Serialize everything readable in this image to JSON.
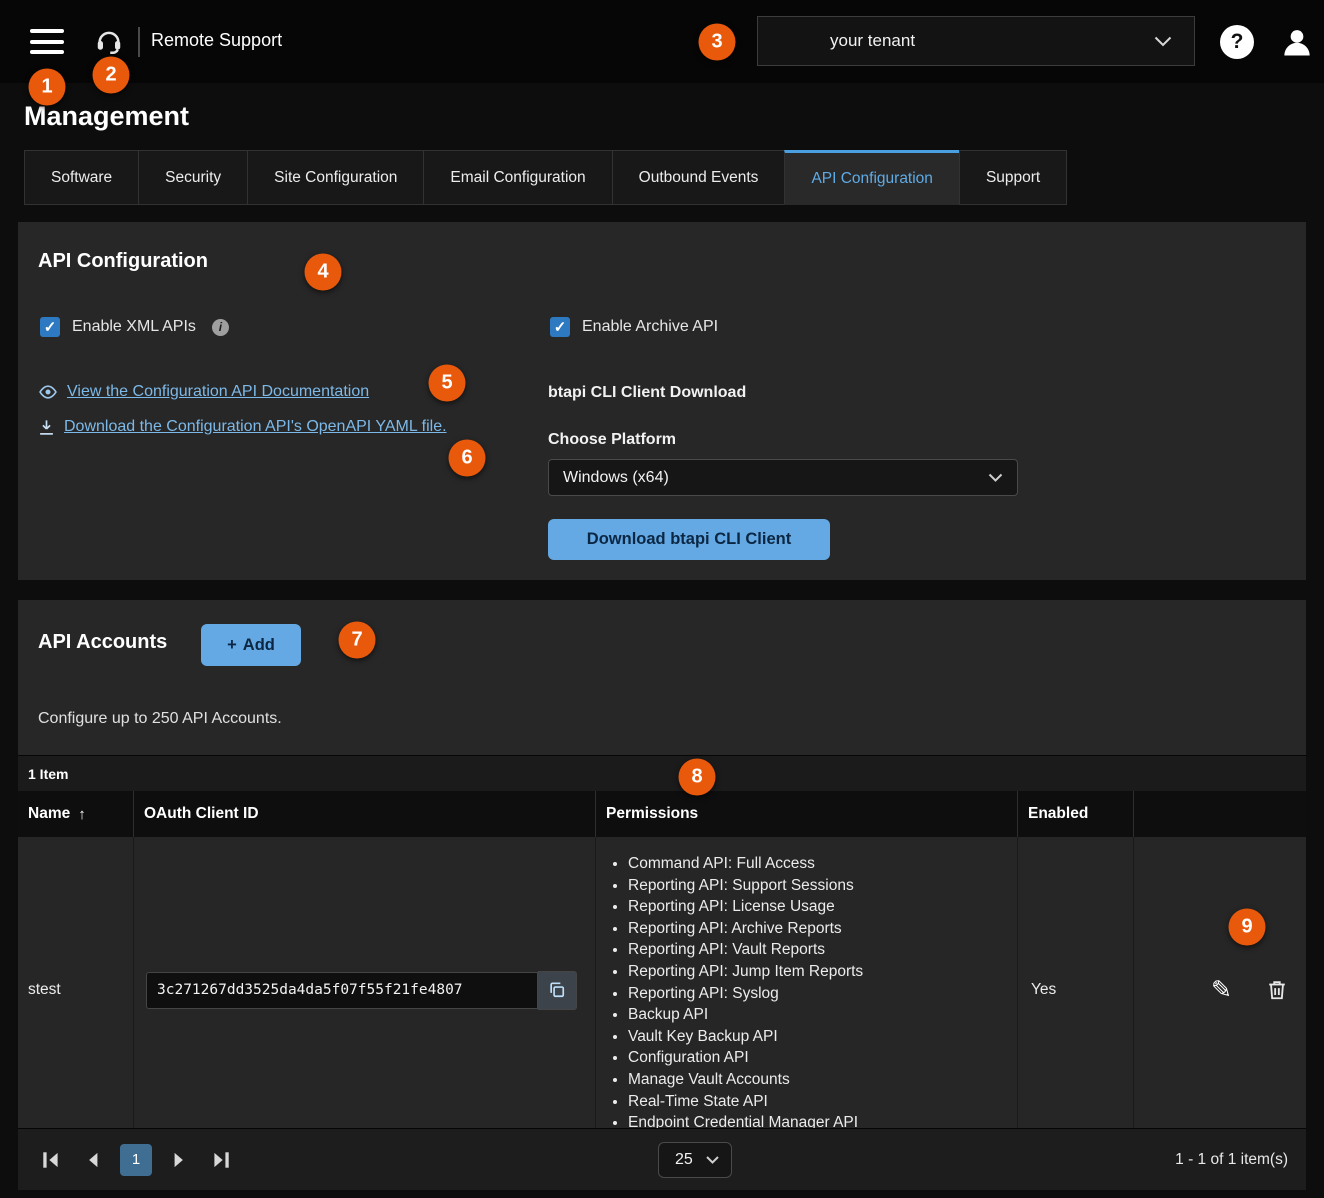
{
  "icons": {
    "help": "?",
    "info": "i",
    "plus": "+",
    "sort_asc": "↑",
    "pencil": "✎"
  },
  "topbar": {
    "product": "Remote Support",
    "tenant": "your tenant"
  },
  "page_title": "Management",
  "tabs": [
    {
      "label": "Software",
      "active": false
    },
    {
      "label": "Security",
      "active": false
    },
    {
      "label": "Site Configuration",
      "active": false
    },
    {
      "label": "Email Configuration",
      "active": false
    },
    {
      "label": "Outbound Events",
      "active": false
    },
    {
      "label": "API Configuration",
      "active": true
    },
    {
      "label": "Support",
      "active": false
    }
  ],
  "api_config": {
    "title": "API Configuration",
    "enable_xml_label": "Enable XML APIs",
    "enable_archive_label": "Enable Archive API",
    "doc_link": "View the Configuration API Documentation",
    "yaml_link": "Download the Configuration API's OpenAPI YAML file.",
    "cli_heading": "btapi CLI Client Download",
    "platform_label": "Choose Platform",
    "platform_value": "Windows (x64)",
    "download_button": "Download btapi CLI Client"
  },
  "accounts": {
    "title": "API Accounts",
    "add_button": "Add",
    "description": "Configure up to 250 API Accounts.",
    "count_label": "1 Item",
    "columns": {
      "name": "Name",
      "oauth": "OAuth Client ID",
      "permissions": "Permissions",
      "enabled": "Enabled"
    },
    "rows": [
      {
        "name": "stest",
        "oauth_client_id": "3c271267dd3525da4da5f07f55f21fe4807",
        "enabled": "Yes",
        "permissions": [
          "Command API: Full Access",
          "Reporting API: Support Sessions",
          "Reporting API: License Usage",
          "Reporting API: Archive Reports",
          "Reporting API: Vault Reports",
          "Reporting API: Jump Item Reports",
          "Reporting API: Syslog",
          "Backup API",
          "Vault Key Backup API",
          "Configuration API",
          "Manage Vault Accounts",
          "Real-Time State API",
          "Endpoint Credential Manager API"
        ]
      }
    ],
    "pagination": {
      "page": "1",
      "page_size": "25",
      "range": "1 - 1 of 1 item(s)"
    }
  },
  "callouts": [
    "1",
    "2",
    "3",
    "4",
    "5",
    "6",
    "7",
    "8",
    "9"
  ],
  "colors": {
    "accent_blue": "#64a9e4",
    "tab_active_blue": "#5fabe6",
    "link_blue": "#7db9e8",
    "checkbox_blue": "#2e7ac2",
    "callout_orange": "#e8590c"
  }
}
